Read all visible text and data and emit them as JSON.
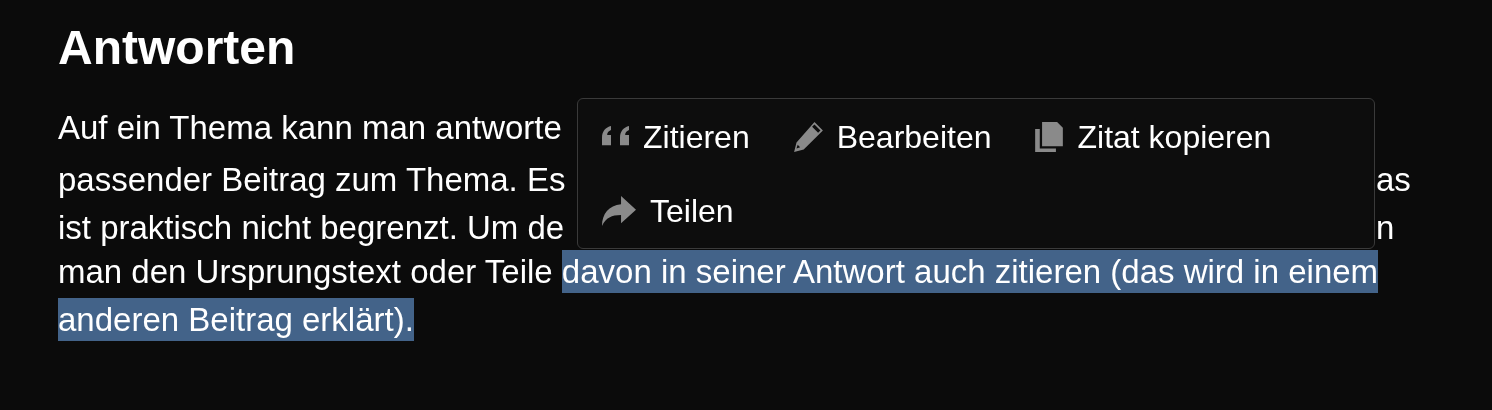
{
  "heading": "Antworten",
  "paragraph_lines": [
    {
      "start": [
        {
          "text": "Auf ein Thema kann man antworte",
          "selected": false
        }
      ]
    },
    {
      "start": [
        {
          "text": "passender Beitrag zum Thema. Es",
          "selected": false
        }
      ],
      "end": "as"
    },
    {
      "start": [
        {
          "text": "ist praktisch nicht begrenzt. Um de",
          "selected": false
        }
      ],
      "end": "n"
    },
    {
      "start": [
        {
          "text": "man den Ursprungstext oder Teile ",
          "selected": false
        },
        {
          "text": "davon in seiner Antwort auch zitieren (das wird in einem",
          "selected": true
        }
      ]
    },
    {
      "start": [
        {
          "text": "anderen Beitrag erklärt).",
          "selected": true
        }
      ]
    }
  ],
  "popup_menu": [
    {
      "kind": "quote",
      "label": "Zitieren"
    },
    {
      "kind": "edit",
      "label": "Bearbeiten"
    },
    {
      "kind": "copy",
      "label": "Zitat kopieren"
    },
    {
      "kind": "share",
      "label": "Teilen"
    }
  ]
}
